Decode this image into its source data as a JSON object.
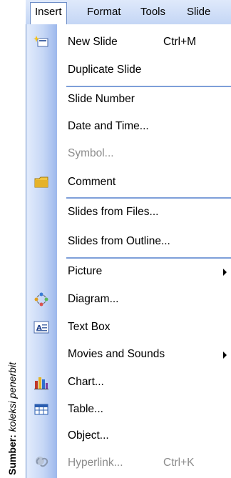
{
  "caption": {
    "source_label": "Sumber:",
    "source_text": "koleksi penerbit"
  },
  "menubar": {
    "insert": "Insert",
    "format": "Format",
    "tools": "Tools",
    "slide": "Slide"
  },
  "menu": {
    "new_slide": {
      "label": "New Slide",
      "shortcut": "Ctrl+M"
    },
    "duplicate_slide": {
      "label": "Duplicate Slide"
    },
    "slide_number": {
      "label": "Slide Number"
    },
    "date_and_time": {
      "label": "Date and Time..."
    },
    "symbol": {
      "label": "Symbol..."
    },
    "comment": {
      "label": "Comment"
    },
    "slides_from_files": {
      "label": "Slides from Files..."
    },
    "slides_from_outline": {
      "label": "Slides from Outline..."
    },
    "picture": {
      "label": "Picture"
    },
    "diagram": {
      "label": "Diagram..."
    },
    "text_box": {
      "label": "Text Box"
    },
    "movies_and_sounds": {
      "label": "Movies and Sounds"
    },
    "chart": {
      "label": "Chart..."
    },
    "table": {
      "label": "Table..."
    },
    "object": {
      "label": "Object..."
    },
    "hyperlink": {
      "label": "Hyperlink...",
      "shortcut": "Ctrl+K"
    }
  }
}
